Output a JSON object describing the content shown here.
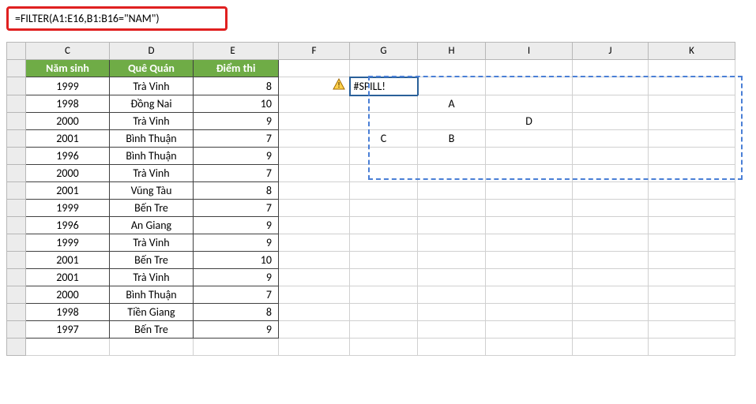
{
  "formula_bar": "=FILTER(A1:E16,B1:B16=\"NAM\")",
  "columns": [
    "C",
    "D",
    "E",
    "F",
    "G",
    "H",
    "I",
    "J",
    "K"
  ],
  "header": {
    "c": "Năm sinh",
    "d": "Quê Quán",
    "e": "Điểm thi"
  },
  "data_rows": [
    {
      "c": "1999",
      "d": "Trà Vinh",
      "e": "8"
    },
    {
      "c": "1998",
      "d": "Đồng Nai",
      "e": "10"
    },
    {
      "c": "2000",
      "d": "Trà Vinh",
      "e": "9"
    },
    {
      "c": "2001",
      "d": "Bình Thuận",
      "e": "7"
    },
    {
      "c": "1996",
      "d": "Bình Thuận",
      "e": "9"
    },
    {
      "c": "2000",
      "d": "Trà Vinh",
      "e": "7"
    },
    {
      "c": "2001",
      "d": "Vũng Tàu",
      "e": "8"
    },
    {
      "c": "1999",
      "d": "Bến Tre",
      "e": "7"
    },
    {
      "c": "1996",
      "d": "An Giang",
      "e": "9"
    },
    {
      "c": "1999",
      "d": "Trà Vinh",
      "e": "9"
    },
    {
      "c": "2001",
      "d": "Bến Tre",
      "e": "10"
    },
    {
      "c": "2001",
      "d": "Trà Vinh",
      "e": "9"
    },
    {
      "c": "2000",
      "d": "Bình Thuận",
      "e": "7"
    },
    {
      "c": "1998",
      "d": "Tiền Giang",
      "e": "8"
    },
    {
      "c": "1997",
      "d": "Bến Tre",
      "e": "9"
    }
  ],
  "spill_error": "#SPILL!",
  "blockers": {
    "h3": "A",
    "i4": "D",
    "g5": "C",
    "h5": "B"
  }
}
